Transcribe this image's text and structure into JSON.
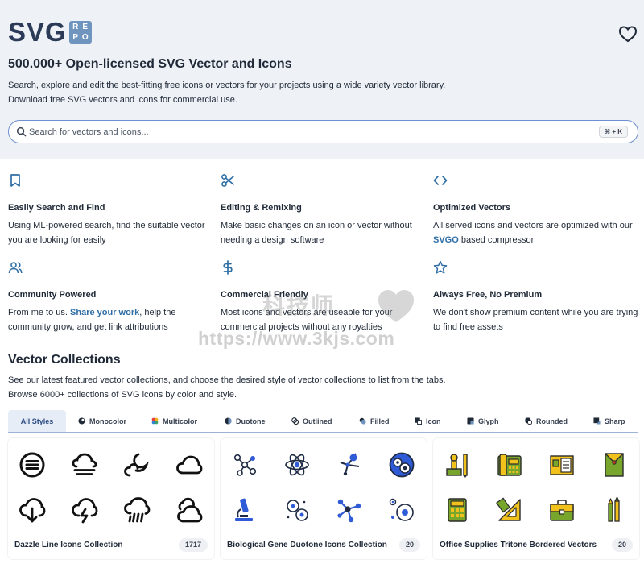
{
  "logo": {
    "word": "SVG",
    "badge": [
      "R",
      "E",
      "P",
      "O"
    ]
  },
  "hero": {
    "title": "500.000+ Open-licensed SVG Vector and Icons",
    "desc1": "Search, explore and edit the best-fitting free icons or vectors for your projects using a wide variety vector library.",
    "desc2": "Download free SVG vectors and icons for commercial use."
  },
  "search": {
    "placeholder": "Search for vectors and icons...",
    "shortcut": "⌘ + K"
  },
  "features": [
    {
      "icon": "bookmark-icon",
      "title": "Easily Search and Find",
      "desc": "Using ML-powered search, find the suitable vector you are looking for easily"
    },
    {
      "icon": "scissors-icon",
      "title": "Editing & Remixing",
      "desc": "Make basic changes on an icon or vector without needing a design software"
    },
    {
      "icon": "code-icon",
      "title": "Optimized Vectors",
      "desc_pre": "All served icons and vectors are optimized with our ",
      "link": "SVGO",
      "desc_post": " based compressor"
    },
    {
      "icon": "users-icon",
      "title": "Community Powered",
      "desc_pre": "From me to us. ",
      "link": "Share your work",
      "desc_post": ", help the community grow, and get link attributions"
    },
    {
      "icon": "dollar-icon",
      "title": "Commercial Friendly",
      "desc": "Most icons and vectors are useable for your commercial projects without any royalties"
    },
    {
      "icon": "star-icon",
      "title": "Always Free, No Premium",
      "desc": "We don't show premium content while you are trying to find free assets"
    }
  ],
  "collections": {
    "title": "Vector Collections",
    "desc1": "See our latest featured vector collections, and choose the desired style of vector collections to list from the tabs.",
    "desc2": "Browse 6000+ collections of SVG icons by color and style."
  },
  "tabs": [
    {
      "label": "All Styles",
      "icon": "",
      "active": true
    },
    {
      "label": "Monocolor",
      "icon": "monocolor-icon"
    },
    {
      "label": "Multicolor",
      "icon": "multicolor-icon"
    },
    {
      "label": "Duotone",
      "icon": "duotone-icon"
    },
    {
      "label": "Outlined",
      "icon": "outlined-icon"
    },
    {
      "label": "Filled",
      "icon": "filled-icon"
    },
    {
      "label": "Icon",
      "icon": "icon-style-icon"
    },
    {
      "label": "Glyph",
      "icon": "glyph-icon"
    },
    {
      "label": "Rounded",
      "icon": "rounded-icon"
    },
    {
      "label": "Sharp",
      "icon": "sharp-icon"
    }
  ],
  "cards": [
    {
      "title": "Dazzle Line Icons Collection",
      "count": "1717",
      "icons": [
        "menu-circle-icon",
        "fog-icon",
        "moon-cloud-icon",
        "cloud-icon",
        "cloud-download-icon",
        "cloud-lightning-icon",
        "cloud-rain-icon",
        "clouds-icon"
      ]
    },
    {
      "title": "Biological Gene Duotone Icons Collection",
      "count": "20",
      "icons": [
        "molecule-icon",
        "atom-icon",
        "molecule-structure-icon",
        "cell-icon",
        "microscope-icon",
        "bacteria-icon",
        "network-icon",
        "cells-icon"
      ]
    },
    {
      "title": "Office Supplies Tritone Bordered Vectors",
      "count": "20",
      "icons": [
        "stamp-icon",
        "telephone-icon",
        "document-icon",
        "envelope-icon",
        "calculator-icon",
        "ruler-icon",
        "briefcase-icon",
        "pens-icon"
      ]
    }
  ],
  "watermark": {
    "name": "科技师",
    "url": "https://www.3kjs.com"
  },
  "colors": {
    "accent": "#2f6fa6",
    "hero_bg": "#eef1f6",
    "logo_text": "#2b3a57",
    "logo_badge": "#6f94bd",
    "search_border": "#6e8fd0"
  }
}
